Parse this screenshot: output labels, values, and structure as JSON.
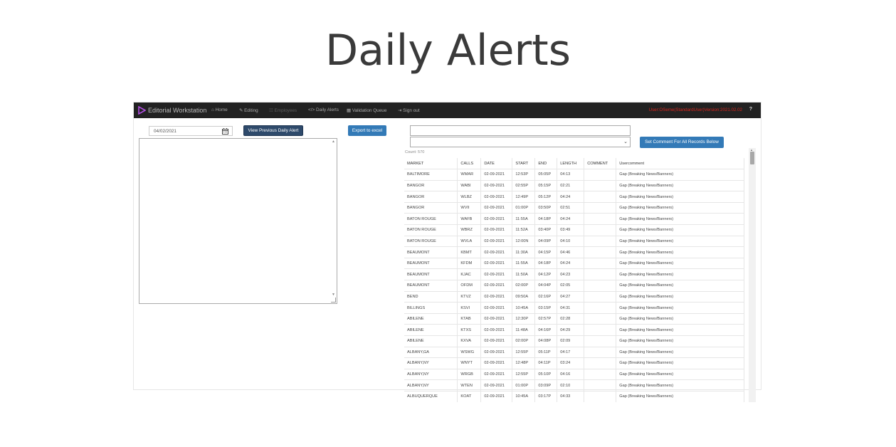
{
  "slide_title": "Daily Alerts",
  "navbar": {
    "brand": "Editorial Workstation",
    "items": [
      {
        "label": "Home",
        "icon": "home-icon",
        "disabled": false
      },
      {
        "label": "Editing",
        "icon": "edit-icon",
        "disabled": false
      },
      {
        "label": "Employees",
        "icon": "users-icon",
        "disabled": true
      },
      {
        "label": "Daily Alerts",
        "icon": "code-icon",
        "disabled": false
      },
      {
        "label": "Validation Queue",
        "icon": "calendar-icon",
        "disabled": false
      },
      {
        "label": "Sign out",
        "icon": "sign-out-icon",
        "disabled": false
      }
    ],
    "user_info": "User:OSeme(StandardUser)Version:2021.02.02",
    "help": "?"
  },
  "controls": {
    "date_value": "04/02/2021",
    "view_previous_label": "View Previous Daily Alert",
    "export_label": "Export to excel",
    "set_comment_label": "Set Comment For All Records Below",
    "count_label": "Count: 570"
  },
  "table": {
    "columns": [
      "MARKET",
      "CALLS",
      "DATE",
      "START",
      "END",
      "LENGTH",
      "COMMENT",
      "Usercomment"
    ],
    "rows": [
      [
        "BALTIMORE",
        "WMAR",
        "02-09-2021",
        "12:53P",
        "05:05P",
        "04:13",
        "",
        "Gap (Breaking News/Banners)"
      ],
      [
        "BANGOR",
        "WABI",
        "02-09-2021",
        "02:55P",
        "05:15P",
        "02:21",
        "",
        "Gap (Breaking News/Banners)"
      ],
      [
        "BANGOR",
        "WLBZ",
        "02-09-2021",
        "12:49P",
        "05:12P",
        "04:24",
        "",
        "Gap (Breaking News/Banners)"
      ],
      [
        "BANGOR",
        "WVII",
        "02-09-2021",
        "01:00P",
        "03:50P",
        "02:51",
        "",
        "Gap (Breaking News/Banners)"
      ],
      [
        "BATON ROUGE",
        "WAFB",
        "02-09-2021",
        "11:55A",
        "04:18P",
        "04:24",
        "",
        "Gap (Breaking News/Banners)"
      ],
      [
        "BATON ROUGE",
        "WBRZ",
        "02-09-2021",
        "11:52A",
        "03:40P",
        "03:49",
        "",
        "Gap (Breaking News/Banners)"
      ],
      [
        "BATON ROUGE",
        "WVLA",
        "02-09-2021",
        "12:00N",
        "04:09P",
        "04:10",
        "",
        "Gap (Breaking News/Banners)"
      ],
      [
        "BEAUMONT",
        "KBMT",
        "02-09-2021",
        "11:30A",
        "04:15P",
        "04:46",
        "",
        "Gap (Breaking News/Banners)"
      ],
      [
        "BEAUMONT",
        "KFDM",
        "02-09-2021",
        "11:55A",
        "04:18P",
        "04:24",
        "",
        "Gap (Breaking News/Banners)"
      ],
      [
        "BEAUMONT",
        "KJAC",
        "02-09-2021",
        "11:50A",
        "04:12P",
        "04:23",
        "",
        "Gap (Breaking News/Banners)"
      ],
      [
        "BEAUMONT",
        "OFDM",
        "02-09-2021",
        "02:00P",
        "04:04P",
        "02:05",
        "",
        "Gap (Breaking News/Banners)"
      ],
      [
        "BEND",
        "KTVZ",
        "02-09-2021",
        "09:50A",
        "02:16P",
        "04:27",
        "",
        "Gap (Breaking News/Banners)"
      ],
      [
        "BILLINGS",
        "KSVI",
        "02-09-2021",
        "10:45A",
        "03:15P",
        "04:31",
        "",
        "Gap (Breaking News/Banners)"
      ],
      [
        "ABILENE",
        "KTAB",
        "02-09-2021",
        "12:30P",
        "02:57P",
        "02:28",
        "",
        "Gap (Breaking News/Banners)"
      ],
      [
        "ABILENE",
        "KTXS",
        "02-09-2021",
        "11:48A",
        "04:16P",
        "04:29",
        "",
        "Gap (Breaking News/Banners)"
      ],
      [
        "ABILENE",
        "KXVA",
        "02-09-2021",
        "02:00P",
        "04:08P",
        "02:09",
        "",
        "Gap (Breaking News/Banners)"
      ],
      [
        "ALBANY,GA",
        "WSWG",
        "02-09-2021",
        "12:55P",
        "05:11P",
        "04:17",
        "",
        "Gap (Breaking News/Banners)"
      ],
      [
        "ALBANY,NY",
        "WNYT",
        "02-09-2021",
        "12:48P",
        "04:11P",
        "03:24",
        "",
        "Gap (Breaking News/Banners)"
      ],
      [
        "ALBANY,NY",
        "WRGB",
        "02-09-2021",
        "12:55P",
        "05:10P",
        "04:16",
        "",
        "Gap (Breaking News/Banners)"
      ],
      [
        "ALBANY,NY",
        "WTEN",
        "02-09-2021",
        "01:00P",
        "03:09P",
        "02:10",
        "",
        "Gap (Breaking News/Banners)"
      ],
      [
        "ALBUQUERQUE",
        "KOAT",
        "02-09-2021",
        "10:45A",
        "03:17P",
        "04:33",
        "",
        "Gap (Breaking News/Banners)"
      ]
    ]
  }
}
